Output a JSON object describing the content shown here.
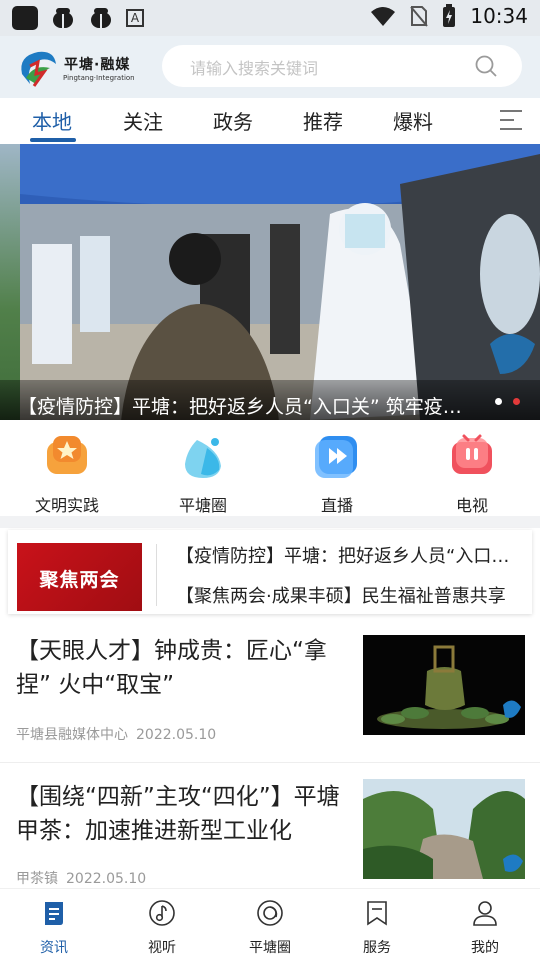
{
  "status_bar": {
    "time": "10:34",
    "icons": [
      "app-icon",
      "bug-icon",
      "bug-icon",
      "a-icon",
      "wifi-icon",
      "no-sim-icon",
      "battery-icon"
    ]
  },
  "header": {
    "logo_cn": "平塘·融媒",
    "logo_en": "Pingtang·Integration",
    "search_placeholder": "请输入搜索关键词"
  },
  "tabs": [
    {
      "label": "本地",
      "active": true
    },
    {
      "label": "关注",
      "active": false
    },
    {
      "label": "政务",
      "active": false
    },
    {
      "label": "推荐",
      "active": false
    },
    {
      "label": "爆料",
      "active": false
    }
  ],
  "banner": {
    "caption": "【疫情防控】平塘：把好返乡人员“入口关” 筑牢疫情防控",
    "slides": 2,
    "active_slide": 2
  },
  "quick_links": [
    {
      "label": "文明实践",
      "icon": "star-badge-icon",
      "color": "#f28a2e"
    },
    {
      "label": "平塘圈",
      "icon": "drop-icon",
      "color": "#3bb8e8"
    },
    {
      "label": "直播",
      "icon": "play-icon",
      "color": "#2f8ef0"
    },
    {
      "label": "电视",
      "icon": "tv-icon",
      "color": "#f0515d"
    }
  ],
  "focus": {
    "badge": "聚焦两会",
    "lines": [
      "【疫情防控】平塘：把好返乡人员“入口关” 筑牢疫情防控",
      "【聚焦两会·成果丰硕】民生福祉普惠共享"
    ]
  },
  "news": [
    {
      "title": "【天眼人才】钟成贵：匠心“拿捏” 火中“取宝”",
      "source": "平塘县融媒体中心",
      "date": "2022.05.10"
    },
    {
      "title": "【围绕“四新”主攻“四化”】平塘甲茶：加速推进新型工业化",
      "source": "甲茶镇",
      "date": "2022.05.10"
    }
  ],
  "bottom_nav": [
    {
      "label": "资讯",
      "icon": "news-icon",
      "active": true
    },
    {
      "label": "视听",
      "icon": "music-icon",
      "active": false
    },
    {
      "label": "平塘圈",
      "icon": "circle-icon",
      "active": false
    },
    {
      "label": "服务",
      "icon": "bookmark-icon",
      "active": false
    },
    {
      "label": "我的",
      "icon": "user-icon",
      "active": false
    }
  ],
  "colors": {
    "accent": "#1f5fa8",
    "badge_red": "#c9121a"
  }
}
